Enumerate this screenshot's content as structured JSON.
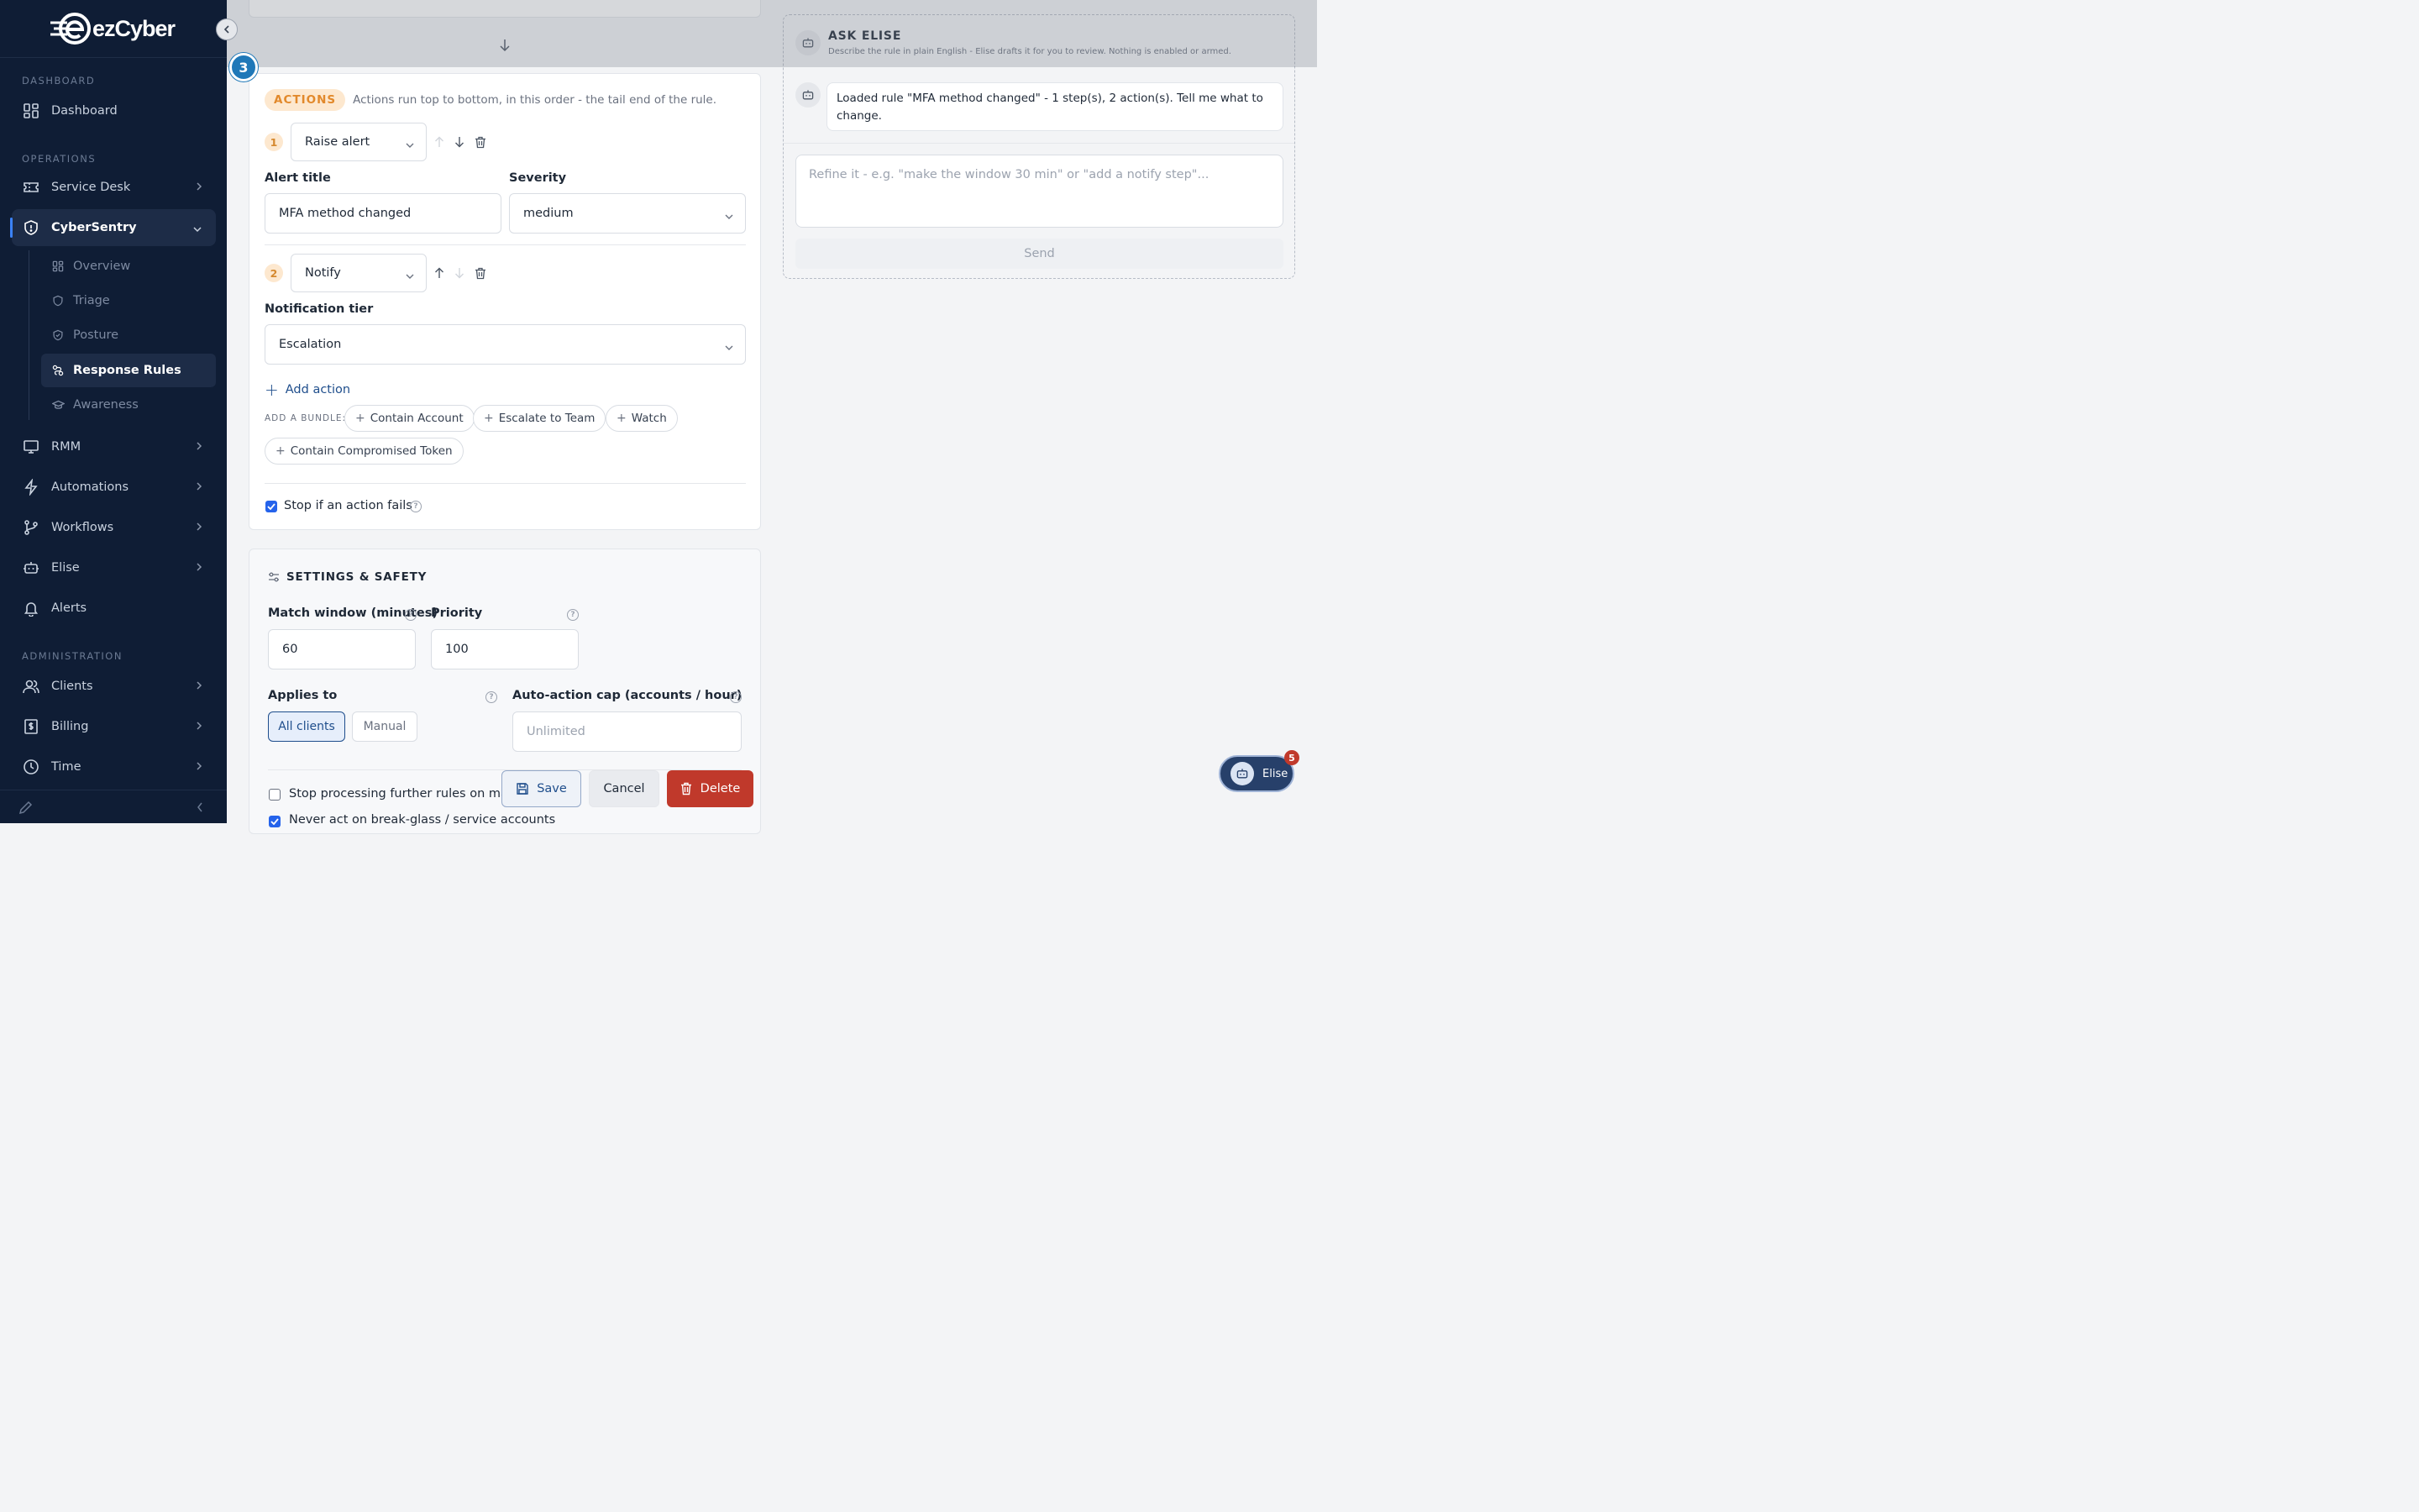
{
  "brand": {
    "name": "ezCyber",
    "accent": "#3b82f6",
    "sidebar_bg": "#0f1d35"
  },
  "sidebar": {
    "sections": {
      "dashboard": "DASHBOARD",
      "operations": "OPERATIONS",
      "administration": "ADMINISTRATION"
    },
    "items": {
      "dashboard": "Dashboard",
      "service_desk": "Service Desk",
      "cybersentry": "CyberSentry",
      "rmm": "RMM",
      "automations": "Automations",
      "workflows": "Workflows",
      "elise": "Elise",
      "alerts": "Alerts",
      "clients": "Clients",
      "billing": "Billing",
      "time": "Time"
    },
    "sub_items": {
      "overview": "Overview",
      "triage": "Triage",
      "posture": "Posture",
      "response_rules": "Response Rules",
      "awareness": "Awareness"
    }
  },
  "step": {
    "number": "3"
  },
  "actions": {
    "pill": "ACTIONS",
    "description": "Actions run top to bottom, in this order - the tail end of the rule.",
    "list": [
      {
        "index": "1",
        "type": "Raise alert"
      },
      {
        "index": "2",
        "type": "Notify"
      }
    ],
    "alert_title_label": "Alert title",
    "alert_title_value": "MFA method changed",
    "severity_label": "Severity",
    "severity_value": "medium",
    "notification_tier_label": "Notification tier",
    "notification_tier_value": "Escalation",
    "add_action": "Add action",
    "bundle_label": "ADD A BUNDLE:",
    "bundles": [
      "Contain Account",
      "Escalate to Team",
      "Watch",
      "Contain Compromised Token"
    ],
    "stop_if_fails": "Stop if an action fails"
  },
  "settings": {
    "title": "SETTINGS & SAFETY",
    "match_window_label": "Match window (minutes)",
    "match_window_value": "60",
    "priority_label": "Priority",
    "priority_value": "100",
    "applies_to_label": "Applies to",
    "applies_all": "All clients",
    "applies_manual": "Manual",
    "cap_label": "Auto-action cap (accounts / hour)",
    "cap_placeholder": "Unlimited",
    "stop_processing": "Stop processing further rules on match",
    "never_act": "Never act on break-glass / service accounts"
  },
  "footer_buttons": {
    "save": "Save",
    "cancel": "Cancel",
    "delete": "Delete"
  },
  "elise": {
    "title": "ASK ELISE",
    "subtitle": "Describe the rule in plain English - Elise drafts it for you to review. Nothing is enabled or armed.",
    "message": "Loaded rule \"MFA method changed\" - 1 step(s), 2 action(s). Tell me what to change.",
    "input_placeholder": "Refine it - e.g. \"make the window 30 min\" or \"add a notify step\"...",
    "send": "Send",
    "fab_label": "Elise",
    "fab_badge": "5"
  }
}
